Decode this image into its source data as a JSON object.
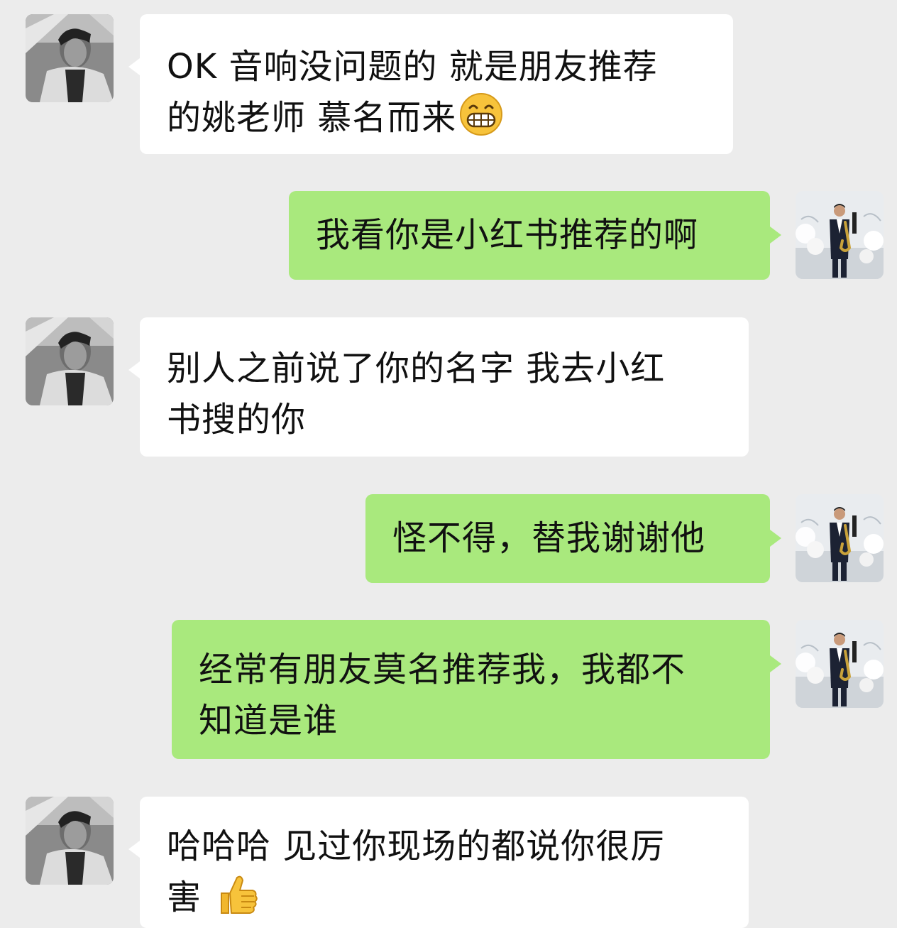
{
  "contact_avatar_icon": "contact-avatar-bw-portrait",
  "self_avatar_icon": "self-avatar-saxophonist",
  "colors": {
    "background": "#ececec",
    "incoming_bubble": "#ffffff",
    "outgoing_bubble": "#a9e97d",
    "text": "#111111"
  },
  "messages": [
    {
      "sender": "contact",
      "lines": [
        "OK 音响没问题的 就是朋友推荐",
        "的姚老师 慕名而来"
      ],
      "emoji": "grinning-face-emoji"
    },
    {
      "sender": "self",
      "lines": [
        "我看你是小红书推荐的啊"
      ]
    },
    {
      "sender": "contact",
      "lines": [
        "别人之前说了你的名字 我去小红",
        "书搜的你"
      ]
    },
    {
      "sender": "self",
      "lines": [
        "怪不得，替我谢谢他"
      ]
    },
    {
      "sender": "self",
      "lines": [
        "经常有朋友莫名推荐我，我都不",
        "知道是谁"
      ]
    },
    {
      "sender": "contact",
      "lines": [
        "哈哈哈 见过你现场的都说你很厉",
        "害 "
      ],
      "emoji": "thumbs-up-emoji"
    }
  ]
}
